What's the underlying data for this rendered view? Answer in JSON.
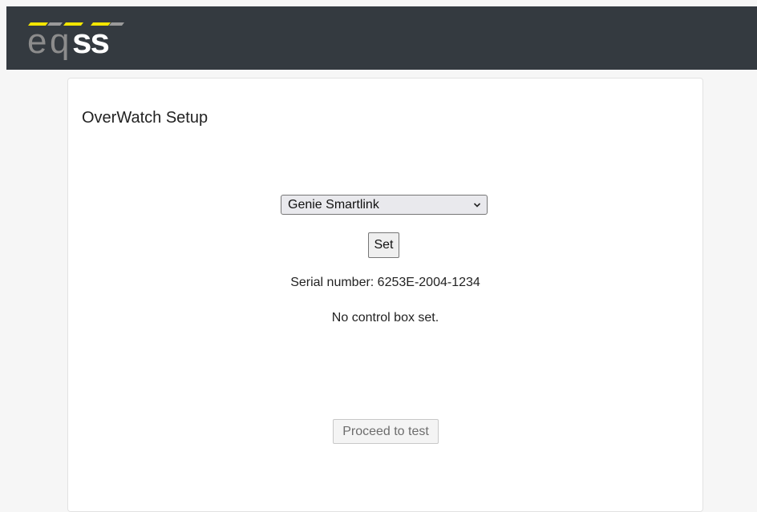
{
  "navbar": {
    "logo_text": "eqss",
    "logo_accent_color": "#f2e500",
    "background_color": "#343a40"
  },
  "setup": {
    "title": "OverWatch Setup",
    "control_box_select": {
      "selected": "Genie Smartlink",
      "icon": "chevron-down-icon"
    },
    "set_label": "Set",
    "serial_text": "Serial number: 6253E-2004-1234",
    "status_text": "No control box set.",
    "proceed_label": "Proceed to test",
    "proceed_disabled": true
  }
}
